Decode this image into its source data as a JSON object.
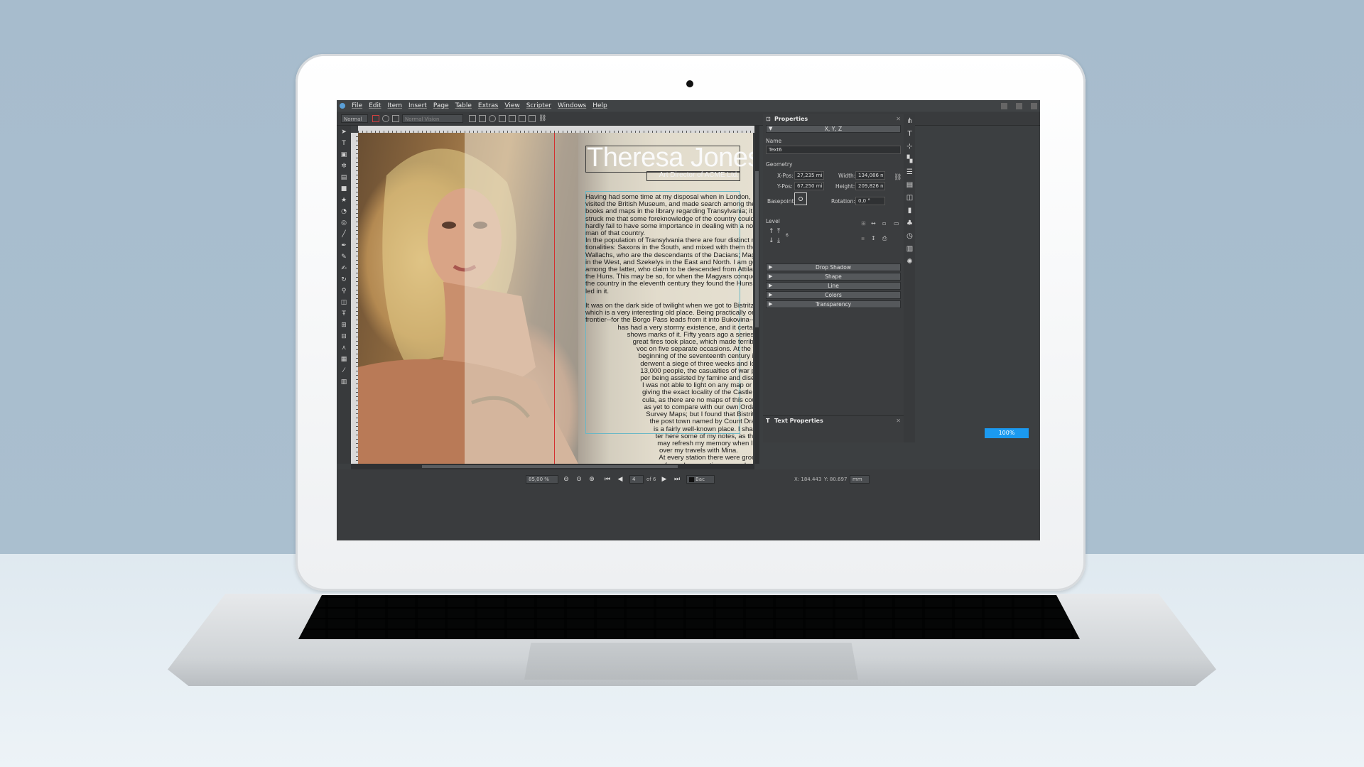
{
  "menubar": {
    "items": [
      "File",
      "Edit",
      "Item",
      "Insert",
      "Page",
      "Table",
      "Extras",
      "View",
      "Scripter",
      "Windows",
      "Help"
    ]
  },
  "toolbar": {
    "mode": "Normal",
    "vision": "Normal Vision"
  },
  "document": {
    "title": "Theresa Jones",
    "subtitle": "Art Director of ACME Ltd.",
    "body": "Having had some time at my disposal when in London, I had\nvisited the British Museum, and made search among the\nbooks and maps in the library regarding Transylvania; it had\nstruck me that some foreknowledge of the country could\nhardly fail to have some importance in dealing with a noble-\nman of that country.\nIn the population of Transylvania there are four distinct na-\ntionalities: Saxons in the South, and mixed with them the\nWallachs, who are the descendants of the Dacians; Magyars\nin the West, and Szekelys in the East and North. I am going\namong the latter, who claim to be descended from Attila and\nthe Huns. This may be so, for when the Magyars conquered\nthe country in the eleventh century they found the Huns sett-\nled in it.\n\nIt was on the dark side of twilight when we got to Bistritz,\nwhich is a very interesting old place. Being practically on the\nfrontier--for the Borgo Pass leads from it into Bukovina--it\n                 has had a very stormy existence, and it certainly\n                      shows marks of it. Fifty years ago a series of\n                         great fires took place, which made terrible ha-\n                           voc on five separate occasions. At the very\n                            beginning of the seventeenth century it un-\n                             derwent a siege of three weeks and lost\n                             13,000 people, the casualties of war pro-\n                             per being assisted by famine and disease.\n                              I was not able to light on any map or work\n                              giving the exact locality of the Castle Dra-\n                              cula, as there are no maps of this country\n                               as yet to compare with our own Ordance\n                                Survey Maps; but I found that Bistritz,\n                                  the post town named by Count Dracula,\n                                    is a fairly well-known place. I shall en-\n                                     ter here some of my notes, as they\n                                      may refresh my memory when I talk\n                                       over my travels with Mina.\n                                       At every station there were groups\n                                        of people, sometimes crowds, and\n                                        in all sorts of attire. Some of them\n                                         were just like the peasants at ho-\n                                         me or those I saw coming through"
  },
  "status": {
    "zoom": "85,00 %",
    "page": "4",
    "page_of": "of 6",
    "layer": "Bac",
    "x_readout": "X: 184.443",
    "y_readout": "Y: 80.697",
    "unit": "mm",
    "zoom_button": "100%"
  },
  "properties": {
    "title": "Properties",
    "xyz": "X, Y, Z",
    "name_label": "Name",
    "name_value": "Text6",
    "geometry_label": "Geometry",
    "xpos_label": "X-Pos:",
    "xpos": "27,235 mi",
    "ypos_label": "Y-Pos:",
    "ypos": "67,250 mi",
    "width_label": "Width:",
    "width": "134,086 n",
    "height_label": "Height:",
    "height": "209,826 n",
    "basepoint_label": "Basepoint:",
    "rotation_label": "Rotation:",
    "rotation": "0,0 °",
    "level_label": "Level",
    "level_value": "6",
    "sections": [
      "Drop Shadow",
      "Shape",
      "Line",
      "Colors",
      "Transparency"
    ],
    "text_properties": "Text Properties"
  },
  "colors": {
    "accent": "#1b9af0",
    "guide": "#d43030",
    "frame": "#69b7c6"
  }
}
